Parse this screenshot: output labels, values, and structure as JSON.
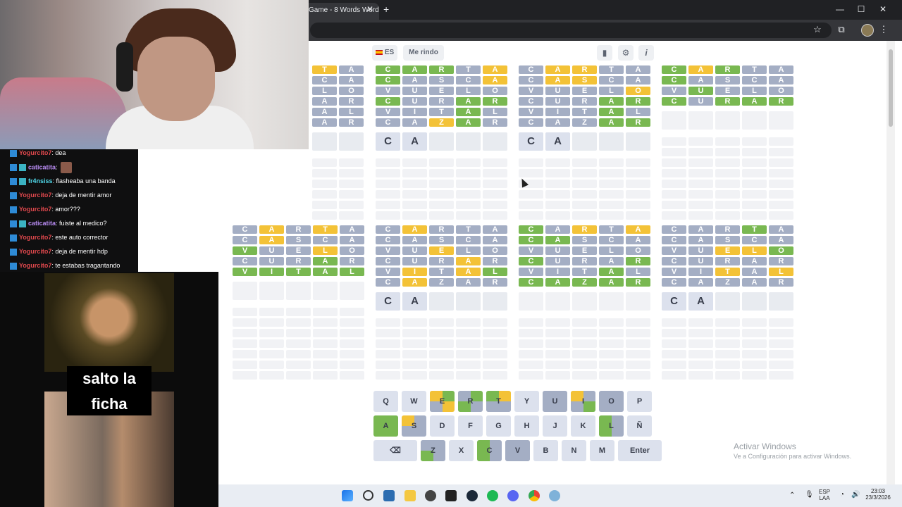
{
  "browser": {
    "tab_title": "Game - 8 Words Word",
    "tab_close": "✕",
    "new_tab": "+",
    "window_buttons": [
      "—",
      "☐",
      "✕"
    ],
    "star_icon": "☆",
    "ext_icon": "⧉",
    "menu_icon": "⋮"
  },
  "game": {
    "lang_button": "ES",
    "give_up_button": "Me rindo",
    "stats_icon": "▮",
    "settings_icon": "⚙",
    "info_icon": "i"
  },
  "boards": [
    {
      "rows": [
        [
          [
            "T",
            "y"
          ],
          [
            "A",
            "x"
          ]
        ],
        [
          [
            "C",
            "x"
          ],
          [
            "A",
            "x"
          ]
        ],
        [
          [
            "L",
            "x"
          ],
          [
            "O",
            "x"
          ]
        ],
        [
          [
            "A",
            "x"
          ],
          [
            "R",
            "x"
          ]
        ],
        [
          [
            "A",
            "x"
          ],
          [
            "L",
            "x"
          ]
        ],
        [
          [
            "A",
            "x"
          ],
          [
            "R",
            "x"
          ]
        ]
      ],
      "current": [
        "",
        ""
      ],
      "cols": 2,
      "partial": true
    },
    {
      "rows": [
        [
          [
            "C",
            "g"
          ],
          [
            "A",
            "g"
          ],
          [
            "R",
            "g"
          ],
          [
            "T",
            "x"
          ],
          [
            "A",
            "y"
          ]
        ],
        [
          [
            "C",
            "g"
          ],
          [
            "A",
            "x"
          ],
          [
            "S",
            "x"
          ],
          [
            "C",
            "x"
          ],
          [
            "A",
            "y"
          ]
        ],
        [
          [
            "V",
            "x"
          ],
          [
            "U",
            "x"
          ],
          [
            "E",
            "x"
          ],
          [
            "L",
            "x"
          ],
          [
            "O",
            "x"
          ]
        ],
        [
          [
            "C",
            "g"
          ],
          [
            "U",
            "x"
          ],
          [
            "R",
            "x"
          ],
          [
            "A",
            "g"
          ],
          [
            "R",
            "g"
          ]
        ],
        [
          [
            "V",
            "x"
          ],
          [
            "I",
            "x"
          ],
          [
            "T",
            "x"
          ],
          [
            "A",
            "g"
          ],
          [
            "L",
            "x"
          ]
        ],
        [
          [
            "C",
            "x"
          ],
          [
            "A",
            "x"
          ],
          [
            "Z",
            "y"
          ],
          [
            "A",
            "g"
          ],
          [
            "R",
            "x"
          ]
        ]
      ],
      "current": [
        "C",
        "A",
        "",
        "",
        ""
      ]
    },
    {
      "rows": [
        [
          [
            "C",
            "x"
          ],
          [
            "A",
            "y"
          ],
          [
            "R",
            "y"
          ],
          [
            "T",
            "x"
          ],
          [
            "A",
            "x"
          ]
        ],
        [
          [
            "C",
            "x"
          ],
          [
            "A",
            "y"
          ],
          [
            "S",
            "y"
          ],
          [
            "C",
            "x"
          ],
          [
            "A",
            "x"
          ]
        ],
        [
          [
            "V",
            "x"
          ],
          [
            "U",
            "x"
          ],
          [
            "E",
            "x"
          ],
          [
            "L",
            "x"
          ],
          [
            "O",
            "y"
          ]
        ],
        [
          [
            "C",
            "x"
          ],
          [
            "U",
            "x"
          ],
          [
            "R",
            "x"
          ],
          [
            "A",
            "g"
          ],
          [
            "R",
            "g"
          ]
        ],
        [
          [
            "V",
            "x"
          ],
          [
            "I",
            "x"
          ],
          [
            "T",
            "x"
          ],
          [
            "A",
            "g"
          ],
          [
            "L",
            "x"
          ]
        ],
        [
          [
            "C",
            "x"
          ],
          [
            "A",
            "x"
          ],
          [
            "Z",
            "x"
          ],
          [
            "A",
            "g"
          ],
          [
            "R",
            "g"
          ]
        ]
      ],
      "current": [
        "C",
        "A",
        "",
        "",
        ""
      ]
    },
    {
      "rows": [
        [
          [
            "C",
            "g"
          ],
          [
            "A",
            "y"
          ],
          [
            "R",
            "g"
          ],
          [
            "T",
            "x"
          ],
          [
            "A",
            "x"
          ]
        ],
        [
          [
            "C",
            "g"
          ],
          [
            "A",
            "x"
          ],
          [
            "S",
            "x"
          ],
          [
            "C",
            "x"
          ],
          [
            "A",
            "x"
          ]
        ],
        [
          [
            "V",
            "x"
          ],
          [
            "U",
            "g"
          ],
          [
            "E",
            "x"
          ],
          [
            "L",
            "x"
          ],
          [
            "O",
            "x"
          ]
        ],
        [
          [
            "C",
            "g"
          ],
          [
            "U",
            "x"
          ],
          [
            "R",
            "g"
          ],
          [
            "A",
            "g"
          ],
          [
            "R",
            "g"
          ]
        ]
      ],
      "current": null
    },
    {
      "rows": [
        [
          [
            "C",
            "x"
          ],
          [
            "A",
            "y"
          ],
          [
            "R",
            "x"
          ],
          [
            "T",
            "y"
          ],
          [
            "A",
            "x"
          ]
        ],
        [
          [
            "C",
            "x"
          ],
          [
            "A",
            "y"
          ],
          [
            "S",
            "x"
          ],
          [
            "C",
            "x"
          ],
          [
            "A",
            "x"
          ]
        ],
        [
          [
            "V",
            "g"
          ],
          [
            "U",
            "x"
          ],
          [
            "E",
            "x"
          ],
          [
            "L",
            "y"
          ],
          [
            "O",
            "x"
          ]
        ],
        [
          [
            "C",
            "x"
          ],
          [
            "U",
            "x"
          ],
          [
            "R",
            "x"
          ],
          [
            "A",
            "g"
          ],
          [
            "R",
            "x"
          ]
        ],
        [
          [
            "V",
            "g"
          ],
          [
            "I",
            "g"
          ],
          [
            "T",
            "g"
          ],
          [
            "A",
            "g"
          ],
          [
            "L",
            "g"
          ]
        ]
      ],
      "current": null
    },
    {
      "rows": [
        [
          [
            "C",
            "x"
          ],
          [
            "A",
            "y"
          ],
          [
            "R",
            "x"
          ],
          [
            "T",
            "x"
          ],
          [
            "A",
            "x"
          ]
        ],
        [
          [
            "C",
            "x"
          ],
          [
            "A",
            "x"
          ],
          [
            "S",
            "x"
          ],
          [
            "C",
            "x"
          ],
          [
            "A",
            "x"
          ]
        ],
        [
          [
            "V",
            "x"
          ],
          [
            "U",
            "x"
          ],
          [
            "E",
            "y"
          ],
          [
            "L",
            "x"
          ],
          [
            "O",
            "x"
          ]
        ],
        [
          [
            "C",
            "x"
          ],
          [
            "U",
            "x"
          ],
          [
            "R",
            "x"
          ],
          [
            "A",
            "y"
          ],
          [
            "R",
            "x"
          ]
        ],
        [
          [
            "V",
            "x"
          ],
          [
            "I",
            "y"
          ],
          [
            "T",
            "x"
          ],
          [
            "A",
            "y"
          ],
          [
            "L",
            "g"
          ]
        ],
        [
          [
            "C",
            "x"
          ],
          [
            "A",
            "y"
          ],
          [
            "Z",
            "x"
          ],
          [
            "A",
            "x"
          ],
          [
            "R",
            "x"
          ]
        ]
      ],
      "current": [
        "C",
        "A",
        "",
        "",
        ""
      ]
    },
    {
      "rows": [
        [
          [
            "C",
            "g"
          ],
          [
            "A",
            "x"
          ],
          [
            "R",
            "y"
          ],
          [
            "T",
            "x"
          ],
          [
            "A",
            "y"
          ]
        ],
        [
          [
            "C",
            "g"
          ],
          [
            "A",
            "g"
          ],
          [
            "S",
            "x"
          ],
          [
            "C",
            "x"
          ],
          [
            "A",
            "x"
          ]
        ],
        [
          [
            "V",
            "x"
          ],
          [
            "U",
            "x"
          ],
          [
            "E",
            "x"
          ],
          [
            "L",
            "x"
          ],
          [
            "O",
            "x"
          ]
        ],
        [
          [
            "C",
            "g"
          ],
          [
            "U",
            "x"
          ],
          [
            "R",
            "x"
          ],
          [
            "A",
            "x"
          ],
          [
            "R",
            "g"
          ]
        ],
        [
          [
            "V",
            "x"
          ],
          [
            "I",
            "x"
          ],
          [
            "T",
            "x"
          ],
          [
            "A",
            "g"
          ],
          [
            "L",
            "x"
          ]
        ],
        [
          [
            "C",
            "g"
          ],
          [
            "A",
            "g"
          ],
          [
            "Z",
            "g"
          ],
          [
            "A",
            "g"
          ],
          [
            "R",
            "g"
          ]
        ]
      ],
      "current": null
    },
    {
      "rows": [
        [
          [
            "C",
            "x"
          ],
          [
            "A",
            "x"
          ],
          [
            "R",
            "x"
          ],
          [
            "T",
            "g"
          ],
          [
            "A",
            "x"
          ]
        ],
        [
          [
            "C",
            "x"
          ],
          [
            "A",
            "x"
          ],
          [
            "S",
            "x"
          ],
          [
            "C",
            "x"
          ],
          [
            "A",
            "x"
          ]
        ],
        [
          [
            "V",
            "x"
          ],
          [
            "U",
            "x"
          ],
          [
            "E",
            "y"
          ],
          [
            "L",
            "y"
          ],
          [
            "O",
            "g"
          ]
        ],
        [
          [
            "C",
            "x"
          ],
          [
            "U",
            "x"
          ],
          [
            "R",
            "x"
          ],
          [
            "A",
            "x"
          ],
          [
            "R",
            "x"
          ]
        ],
        [
          [
            "V",
            "x"
          ],
          [
            "I",
            "x"
          ],
          [
            "T",
            "y"
          ],
          [
            "A",
            "x"
          ],
          [
            "L",
            "y"
          ]
        ],
        [
          [
            "C",
            "x"
          ],
          [
            "A",
            "x"
          ],
          [
            "Z",
            "x"
          ],
          [
            "A",
            "x"
          ],
          [
            "R",
            "x"
          ]
        ]
      ],
      "current": [
        "C",
        "A",
        "",
        "",
        ""
      ]
    }
  ],
  "keyboard": [
    [
      "Q",
      "W",
      "E",
      "R",
      "T",
      "Y",
      "U",
      "I",
      "O",
      "P"
    ],
    [
      "A",
      "S",
      "D",
      "F",
      "G",
      "H",
      "J",
      "K",
      "L",
      "Ñ"
    ],
    [
      "⌫",
      "Z",
      "X",
      "C",
      "V",
      "B",
      "N",
      "M",
      "Enter"
    ]
  ],
  "watermark": {
    "title": "Activar Windows",
    "subtitle": "Ve a Configuración para activar Windows."
  },
  "chat": [
    {
      "user": "Yogurcito7",
      "text": ": dea",
      "color": "#e0484d"
    },
    {
      "user": "caticatita",
      "text": ":",
      "color": "#b98cf3",
      "emote": true
    },
    {
      "user": "fr4nsiss",
      "text": ": flasheaba una banda",
      "color": "#4fd7e8"
    },
    {
      "user": "Yogurcito7",
      "text": ": deja de mentir amor",
      "color": "#e0484d"
    },
    {
      "user": "Yogurcito7",
      "text": ": amor???",
      "color": "#e0484d"
    },
    {
      "user": "caticatita",
      "text": ": fuiste al medico?",
      "color": "#b98cf3"
    },
    {
      "user": "Yogurcito7",
      "text": ": este auto corrector",
      "color": "#e0484d"
    },
    {
      "user": "Yogurcito7",
      "text": ": deja de mentir hdp",
      "color": "#e0484d"
    },
    {
      "user": "Yogurcito7",
      "text": ": te estabas tragantando",
      "color": "#e0484d"
    }
  ],
  "meme_caption_line1": "salto la",
  "meme_caption_line2": "ficha",
  "taskbar": {
    "lang_top": "ESP",
    "lang_bottom": "LAA",
    "time": "23:03",
    "date": "23/3/2026"
  }
}
